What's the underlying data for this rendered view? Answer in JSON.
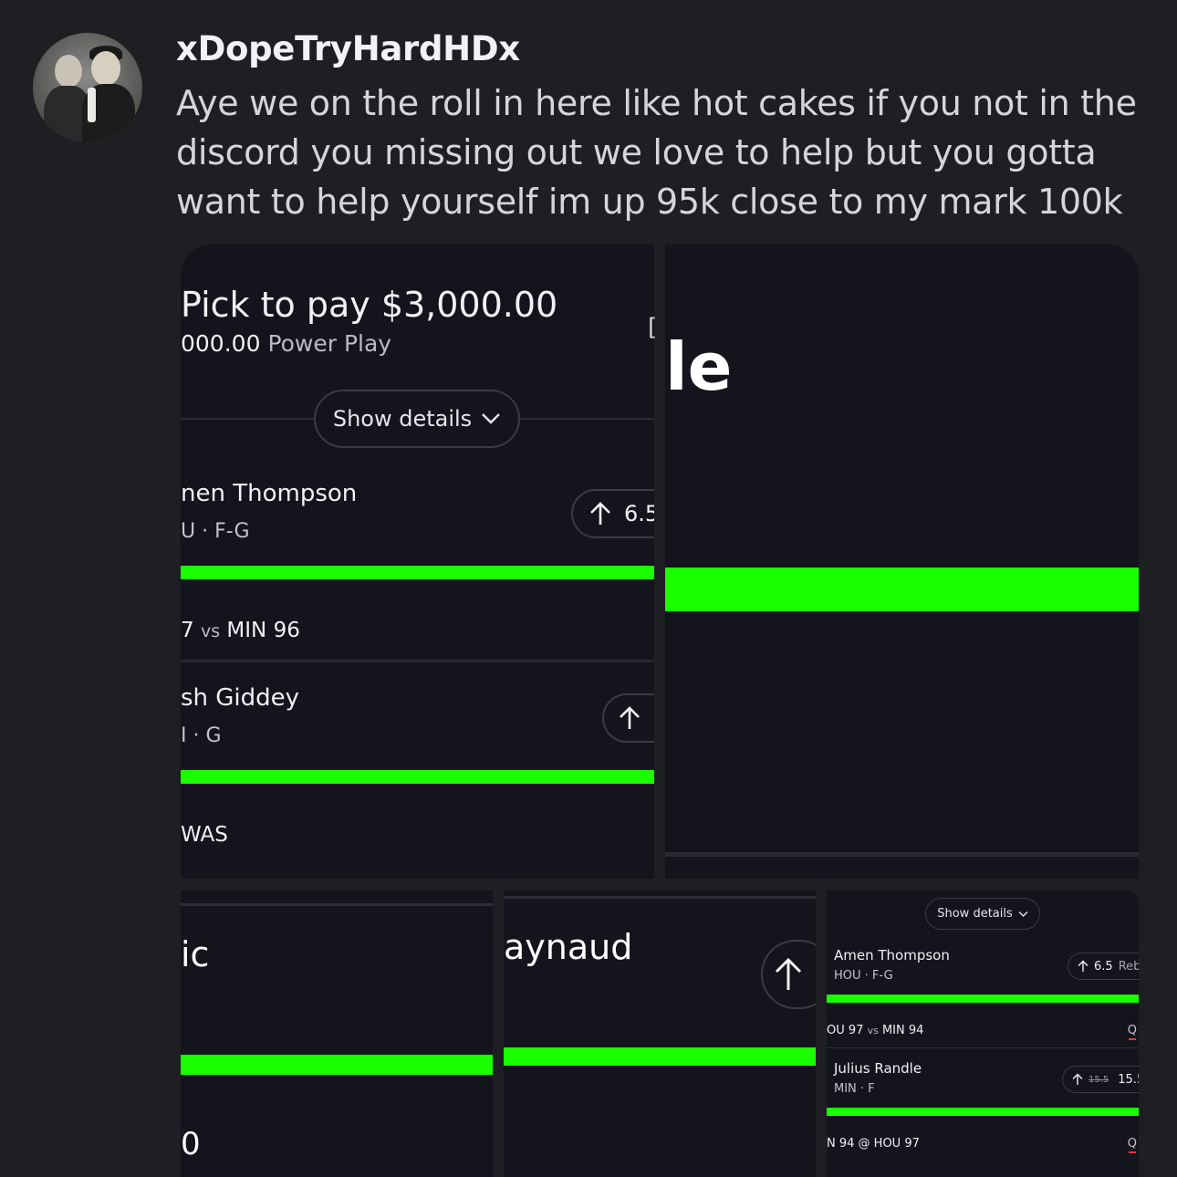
{
  "post": {
    "username": "xDopeTryHardHDx",
    "message": "Aye we on the roll in here like hot cakes if you not in the discord you missing out we love to help but you gotta want to help yourself im up 95k close to my mark 100k"
  },
  "tile1": {
    "title": "Pick to pay $3,000.00",
    "subtitle_amount": "000.00",
    "subtitle_label": "Power Play",
    "show_details": "Show details",
    "player1": {
      "name": "nen Thompson",
      "team": "U · F-G",
      "line": "6.5",
      "score_a": "7",
      "score_vs": "vs",
      "score_b": "MIN 96"
    },
    "player2": {
      "name": "sh Giddey",
      "team": "I · G",
      "score": "WAS"
    },
    "glyph": "["
  },
  "tile2": {
    "big_text": "le"
  },
  "tile3": {
    "big_text": "ic",
    "bottom_text": "0"
  },
  "tile4": {
    "big_text": "aynaud"
  },
  "tile5": {
    "show_details": "Show details",
    "player1": {
      "name": "Amen Thompson",
      "team": "HOU · F-G",
      "line": "6.5",
      "stat": "Reb",
      "score_a": "OU 97",
      "score_vs": "vs",
      "score_b": "MIN 94",
      "q": "Q"
    },
    "player2": {
      "name": "Julius Randle",
      "team": "MIN · F",
      "old_line": "15.5",
      "line": "15.5",
      "score_a": "N 94 @ HOU 97",
      "q": "Q"
    }
  },
  "colors": {
    "background": "#1e1f23",
    "card": "#13141c",
    "progress": "#19ff00",
    "accent_red": "#e03a3a"
  },
  "icons": [
    "chevron-down-icon",
    "arrow-up-icon"
  ]
}
